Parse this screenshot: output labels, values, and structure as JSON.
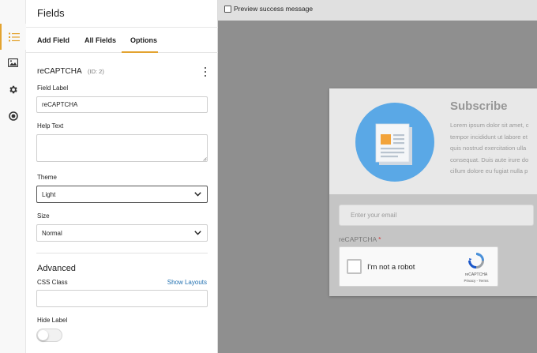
{
  "sidebar_icons": [
    "list-icon",
    "image-icon",
    "gear-icon",
    "circle-dot-icon"
  ],
  "panel": {
    "title": "Fields",
    "tabs": [
      {
        "label": "Add Field",
        "active": false
      },
      {
        "label": "All Fields",
        "active": false
      },
      {
        "label": "Options",
        "active": true
      }
    ],
    "field_name": "reCAPTCHA",
    "field_id": "(ID: 2)",
    "field_label": {
      "label": "Field Label",
      "value": "reCAPTCHA"
    },
    "help_text": {
      "label": "Help Text",
      "value": ""
    },
    "theme": {
      "label": "Theme",
      "value": "Light"
    },
    "size": {
      "label": "Size",
      "value": "Normal"
    },
    "advanced": {
      "title": "Advanced",
      "css_class_label": "CSS Class",
      "css_class_value": "",
      "show_layouts": "Show Layouts",
      "hide_label": "Hide Label",
      "hide_label_on": false
    }
  },
  "preview": {
    "checkbox_label": "Preview success message",
    "checked": false
  },
  "form": {
    "title": "Subscribe",
    "body_lines": [
      "Lorem ipsum dolor sit amet, c",
      "tempor incididunt ut labore et",
      "quis nostrud exercitation ulla",
      "consequat. Duis aute irure do",
      "cillum dolore eu fugiat nulla p"
    ],
    "email_placeholder": "Enter your email",
    "captcha_label": "reCAPTCHA",
    "required_mark": "*",
    "captcha_text": "I'm not a robot",
    "captcha_brand": "reCAPTCHA",
    "captcha_links": "Privacy - Terms"
  },
  "colors": {
    "accent": "#e3a330",
    "link": "#2271b1",
    "circle": "#5aa8e6",
    "required": "#d63638"
  }
}
